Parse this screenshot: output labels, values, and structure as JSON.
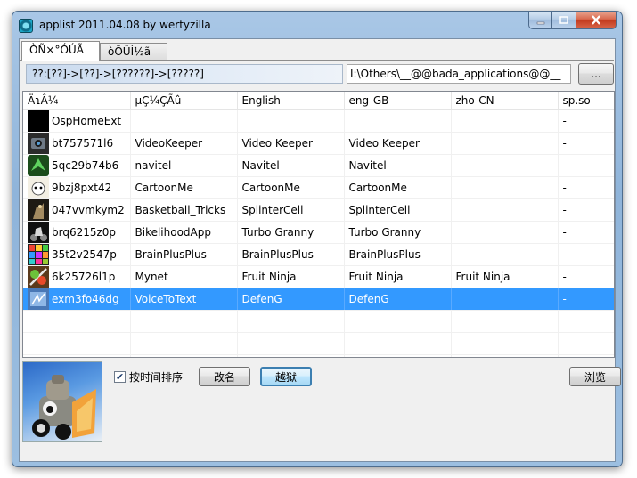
{
  "window": {
    "title": "applist 2011.04.08 by wertyzilla",
    "controls": {
      "minimize": "–",
      "maximize": "□",
      "close": "✕"
    }
  },
  "tabs": [
    {
      "label": "ÒÑ×°ÓÚÃ",
      "active": true
    },
    {
      "label": "òÕÛÌ½ã",
      "active": false
    }
  ],
  "path_display": "??:[??]->[??]->[??????]->[?????]",
  "directory_input": "I:\\Others\\__@@bada_applications@@__",
  "browse_dots_label": "...",
  "table": {
    "columns": [
      "ÄɿÂ¼",
      "µÇ¼ÇÃû",
      "English",
      "eng-GB",
      "zho-CN",
      "sp.so"
    ],
    "rows": [
      {
        "id": "OspHomeExt",
        "name": "",
        "en": "",
        "gb": "",
        "cn": "",
        "sp": "-",
        "icon": "black"
      },
      {
        "id": "bt757571l6",
        "name": "VideoKeeper",
        "en": "Video Keeper",
        "gb": "Video Keeper",
        "cn": "",
        "sp": "-",
        "icon": "videokeeper"
      },
      {
        "id": "5qc29b74b6",
        "name": "navitel",
        "en": "Navitel",
        "gb": "Navitel",
        "cn": "",
        "sp": "-",
        "icon": "navitel"
      },
      {
        "id": "9bzj8pxt42",
        "name": "CartoonMe",
        "en": "CartoonMe",
        "gb": "CartoonMe",
        "cn": "",
        "sp": "-",
        "icon": "cartoonme"
      },
      {
        "id": "047vvmkym2",
        "name": "Basketball_Tricks",
        "en": "SplinterCell",
        "gb": "SplinterCell",
        "cn": "",
        "sp": "-",
        "icon": "splintercell"
      },
      {
        "id": "brq6215z0p",
        "name": "BikelihoodApp",
        "en": "Turbo Granny",
        "gb": "Turbo Granny",
        "cn": "",
        "sp": "-",
        "icon": "turbogranny"
      },
      {
        "id": "35t2v2547p",
        "name": "BrainPlusPlus",
        "en": "BrainPlusPlus",
        "gb": "BrainPlusPlus",
        "cn": "",
        "sp": "-",
        "icon": "brainplus"
      },
      {
        "id": "6k25726l1p",
        "name": "Mynet",
        "en": "Fruit Ninja",
        "gb": "Fruit Ninja",
        "cn": "Fruit Ninja",
        "sp": "-",
        "icon": "fruitninja"
      },
      {
        "id": "exm3fo46dg",
        "name": "VoiceToText",
        "en": "DefenG",
        "gb": "DefenG",
        "cn": "",
        "sp": "-",
        "icon": "voicetotext",
        "selected": true
      }
    ]
  },
  "bottom": {
    "sort_by_time_label": "按时间排序",
    "sort_by_time_checked": true,
    "rename_label": "改名",
    "jailbreak_label": "越狱",
    "browse_label": "浏览"
  },
  "colors": {
    "selection": "#3399ff",
    "title_bar": "#a9c7e6",
    "close_button": "#c2381c"
  }
}
